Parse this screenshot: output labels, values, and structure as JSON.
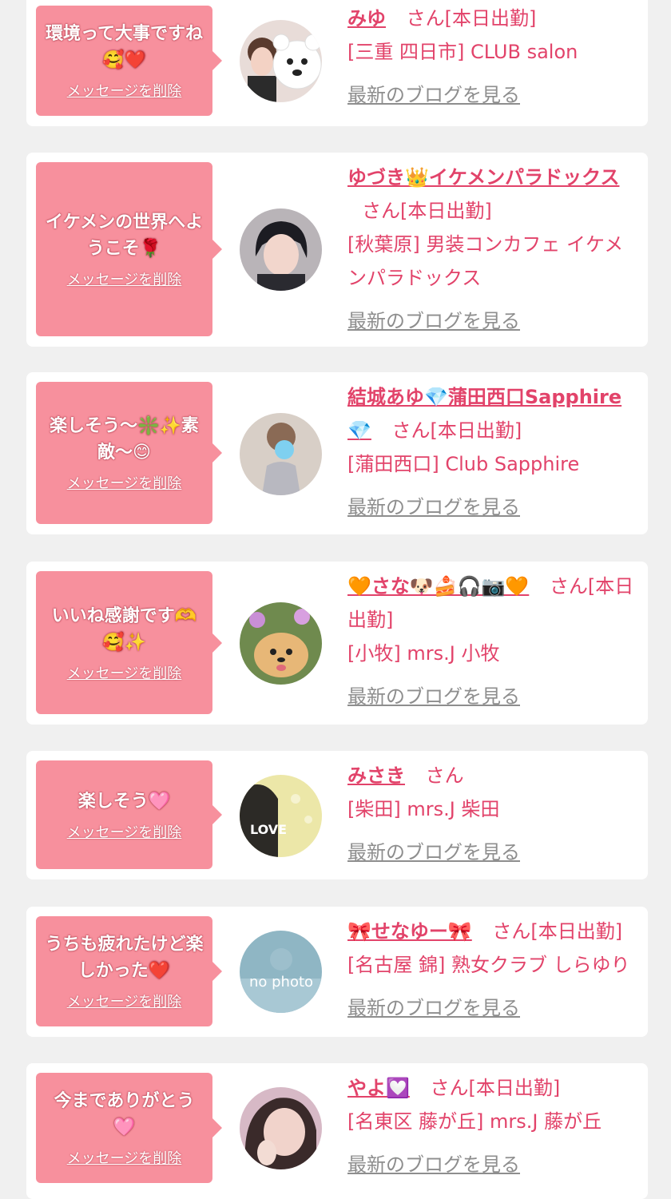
{
  "cards": [
    {
      "message": "環境って大事ですね🥰❤️",
      "delete_label": "メッセージを削除",
      "name": "みゆ",
      "suffix": "さん[本日出勤]",
      "location": "[三重 四日市] CLUB salon",
      "blog_label": "最新のブログを見る",
      "avatar": "girl-with-bear-photo"
    },
    {
      "message": "イケメンの世界へようこそ🌹",
      "delete_label": "メッセージを削除",
      "name": "ゆづき👑イケメンパラドックス",
      "suffix": "さん[本日出勤]",
      "location": "[秋葉原] 男装コンカフェ イケメンパラドックス",
      "blog_label": "最新のブログを見る",
      "avatar": "dark-hair-portrait"
    },
    {
      "message": "楽しそう～❇️✨素敵～😊",
      "delete_label": "メッセージを削除",
      "name": "結城あゆ💎蒲田西口Sapphire💎",
      "suffix": "さん[本日出勤]",
      "location": "[蒲田西口] Club Sapphire",
      "blog_label": "最新のブログを見る",
      "avatar": "dress-portrait"
    },
    {
      "message": "いいね感謝です🫶🥰✨",
      "delete_label": "メッセージを削除",
      "name": "🧡さな🐶🍰🎧📷🧡",
      "suffix": "さん[本日出勤]",
      "location": "[小牧] mrs.J 小牧",
      "blog_label": "最新のブログを見る",
      "avatar": "pomeranian-photo"
    },
    {
      "message": "楽しそう🩷",
      "delete_label": "メッセージを削除",
      "name": "みさき",
      "suffix": "さん",
      "location": "[柴田] mrs.J 柴田",
      "blog_label": "最新のブログを見る",
      "avatar": "love-photo",
      "avatar_text": "LOVE"
    },
    {
      "message": "うちも疲れたけど楽しかった❤️",
      "delete_label": "メッセージを削除",
      "name": "🎀せなゆー🎀",
      "suffix": "さん[本日出勤]",
      "location": "[名古屋 錦] 熟女クラブ しらゆり",
      "blog_label": "最新のブログを見る",
      "avatar": "no-photo",
      "avatar_text": "no photo"
    },
    {
      "message": "今までありがとう🩷",
      "delete_label": "メッセージを削除",
      "name": "やよ💟",
      "suffix": "さん[本日出勤]",
      "location": "[名東区 藤が丘] mrs.J 藤が丘",
      "blog_label": "最新のブログを見る",
      "avatar": "close-up-portrait"
    }
  ],
  "colors": {
    "page_bg": "#f0f0f0",
    "card_bg": "#ffffff",
    "bubble_bg": "#f7909d",
    "accent": "#e2436a",
    "link_gray": "#8e8e8e"
  }
}
